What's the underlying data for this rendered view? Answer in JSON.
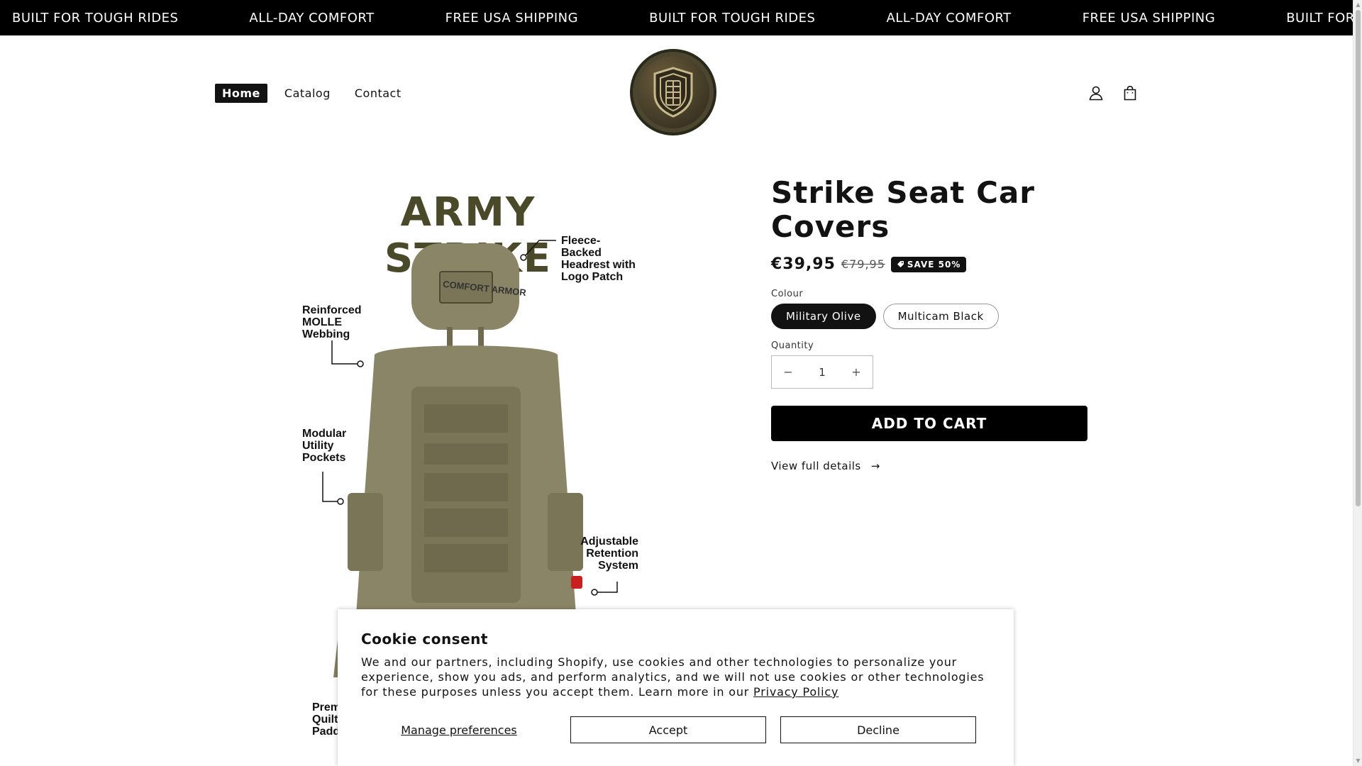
{
  "announcement": {
    "items": [
      "BUILT FOR TOUGH RIDES",
      "ALL-DAY COMFORT",
      "FREE USA SHIPPING",
      "BUILT FOR TOUGH RIDES",
      "ALL-DAY COMFORT",
      "FREE USA SHIPPING",
      "BUILT FOR TO"
    ]
  },
  "header": {
    "nav": [
      {
        "label": "Home",
        "active": true
      },
      {
        "label": "Catalog",
        "active": false
      },
      {
        "label": "Contact",
        "active": false
      }
    ],
    "logo_icon": "shield-logo-icon",
    "icons": [
      "account-icon",
      "cart-icon"
    ]
  },
  "media": {
    "title": "ARMY STRIKE",
    "callouts": {
      "headrest": "Fleece-Backed Headrest with Logo Patch",
      "molle": "Reinforced MOLLE Webbing",
      "pockets": "Modular Utility Pockets",
      "retention": "Adjustable Retention System",
      "padding": "Premium Quilted Padding",
      "patch": "COMFORT ARMOR"
    }
  },
  "product": {
    "title": "Strike Seat Car Covers",
    "price": "€39,95",
    "compare_price": "€79,95",
    "badge": "SAVE 50%",
    "option_label": "Colour",
    "options": [
      {
        "label": "Military Olive",
        "selected": true
      },
      {
        "label": "Multicam Black",
        "selected": false
      }
    ],
    "quantity_label": "Quantity",
    "quantity": "1",
    "qty_minus": "−",
    "qty_plus": "+",
    "add_to_cart": "ADD TO CART",
    "view_details": "View full details",
    "view_details_arrow": "→"
  },
  "cookie": {
    "title": "Cookie consent",
    "text": "We and our partners, including Shopify, use cookies and other technologies to personalize your experience, show you ads, and perform analytics, and we will not use cookies or other technologies for these purposes unless you accept them. Learn more in our",
    "link": "Privacy Policy",
    "manage": "Manage preferences",
    "accept": "Accept",
    "decline": "Decline"
  },
  "colors": {
    "marquee_bg": "#000000",
    "olive": "#8a8566",
    "title_olive": "#4a4a2a",
    "button_bg": "#000000"
  }
}
